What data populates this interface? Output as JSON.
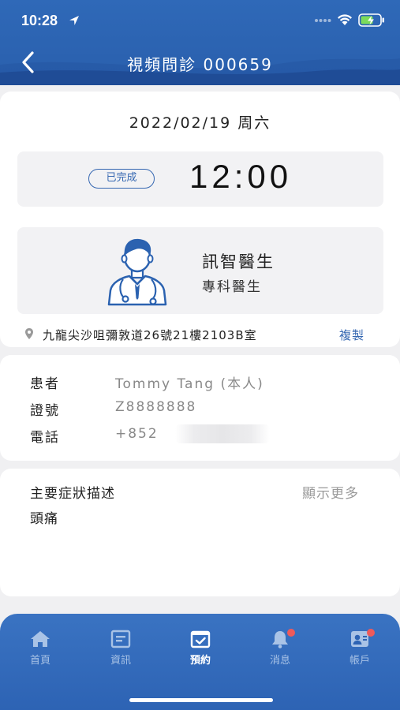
{
  "status_bar": {
    "time": "10:28"
  },
  "nav": {
    "title": "視頻問診 000659"
  },
  "appointment": {
    "date": "2022/02/19 周六",
    "status": "已完成",
    "time": "12:00"
  },
  "doctor": {
    "name": "訊智醫生",
    "title": "專科醫生",
    "address": "九龍尖沙咀彌敦道26號21樓2103B室",
    "copy_label": "複製"
  },
  "patient": {
    "rows": [
      {
        "label": "患者",
        "value": "Tommy Tang (本人)"
      },
      {
        "label": "證號",
        "value": "Z8888888"
      },
      {
        "label": "電話",
        "value": "+852"
      }
    ]
  },
  "symptom": {
    "title": "主要症狀描述",
    "show_more": "顯示更多",
    "text": "頭痛"
  },
  "tabbar": {
    "tabs": [
      {
        "label": "首頁",
        "icon": "home-icon"
      },
      {
        "label": "資訊",
        "icon": "news-icon"
      },
      {
        "label": "預約",
        "icon": "calendar-check-icon",
        "active": true
      },
      {
        "label": "消息",
        "icon": "bell-icon",
        "badge": true
      },
      {
        "label": "帳戶",
        "icon": "account-icon",
        "badge": true
      }
    ]
  },
  "colors": {
    "primary": "#2f69b8",
    "badge": "#ef5a5a",
    "link": "#3567b1"
  }
}
